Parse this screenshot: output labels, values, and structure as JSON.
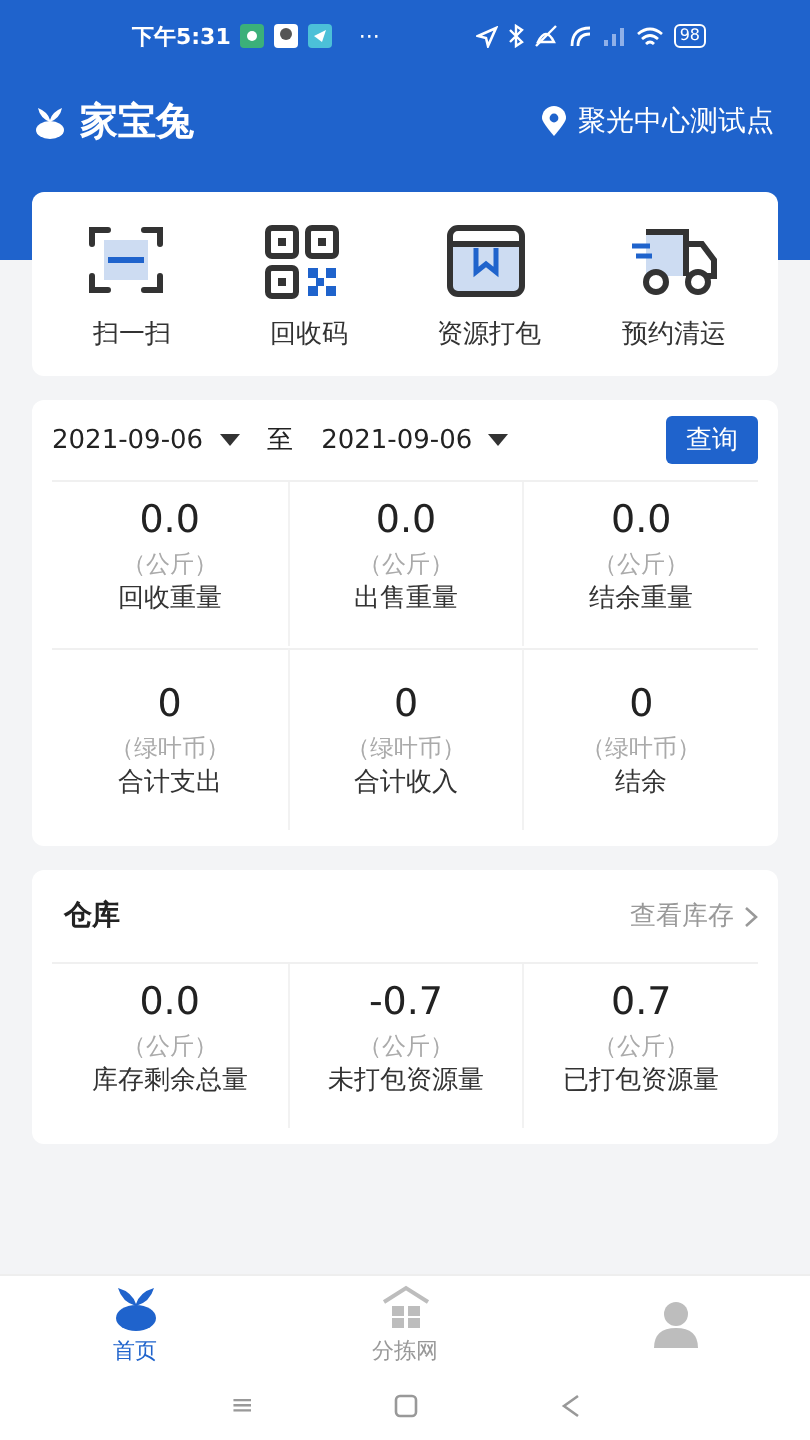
{
  "status_bar": {
    "time": "下午5:31",
    "more": "···",
    "battery": "98"
  },
  "header": {
    "app_name": "家宝兔",
    "location": "聚光中心测试点"
  },
  "shortcuts": [
    {
      "label": "扫一扫",
      "kind": "scan"
    },
    {
      "label": "回收码",
      "kind": "qr"
    },
    {
      "label": "资源打包",
      "kind": "package"
    },
    {
      "label": "预约清运",
      "kind": "truck"
    }
  ],
  "date_filter": {
    "start": "2021-09-06",
    "separator": "至",
    "end": "2021-09-06",
    "button": "查询"
  },
  "stats": [
    {
      "value": "0.0",
      "unit": "（公斤）",
      "label": "回收重量"
    },
    {
      "value": "0.0",
      "unit": "（公斤）",
      "label": "出售重量"
    },
    {
      "value": "0.0",
      "unit": "（公斤）",
      "label": "结余重量"
    },
    {
      "value": "0",
      "unit": "（绿叶币）",
      "label": "合计支出"
    },
    {
      "value": "0",
      "unit": "（绿叶币）",
      "label": "合计收入"
    },
    {
      "value": "0",
      "unit": "（绿叶币）",
      "label": "结余"
    }
  ],
  "warehouse": {
    "title": "仓库",
    "link": "查看库存",
    "stats": [
      {
        "value": "0.0",
        "unit": "（公斤）",
        "label": "库存剩余总量"
      },
      {
        "value": "-0.7",
        "unit": "（公斤）",
        "label": "未打包资源量"
      },
      {
        "value": "0.7",
        "unit": "（公斤）",
        "label": "已打包资源量"
      }
    ]
  },
  "tabs": [
    {
      "label": "首页",
      "kind": "home",
      "selected": true
    },
    {
      "label": "分拣网",
      "kind": "station",
      "selected": false
    },
    {
      "kind": "person",
      "selected": false
    }
  ],
  "nav_bar": {
    "menu": "≡"
  }
}
